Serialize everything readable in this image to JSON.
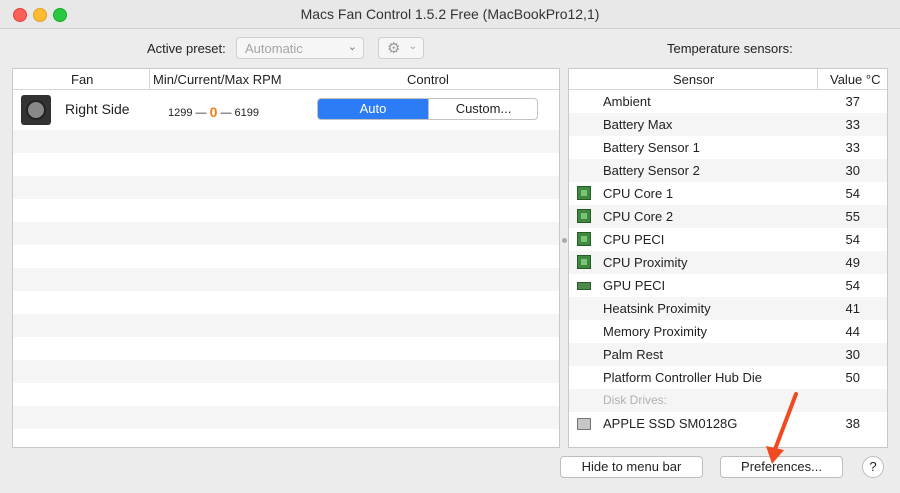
{
  "window": {
    "title": "Macs Fan Control 1.5.2 Free (MacBookPro12,1)"
  },
  "toolbar": {
    "preset_label": "Active preset:",
    "preset_value": "Automatic",
    "sensors_label": "Temperature sensors:"
  },
  "fan_table": {
    "headers": {
      "fan": "Fan",
      "rpm": "Min/Current/Max RPM",
      "control": "Control"
    },
    "fans": [
      {
        "name": "Right Side",
        "min": "1299",
        "current": "0",
        "max": "6199",
        "auto_label": "Auto",
        "custom_label": "Custom..."
      }
    ]
  },
  "sensor_table": {
    "headers": {
      "sensor": "Sensor",
      "value": "Value °C"
    },
    "sensors": [
      {
        "name": "Ambient",
        "value": "37",
        "icon": "none"
      },
      {
        "name": "Battery Max",
        "value": "33",
        "icon": "none"
      },
      {
        "name": "Battery Sensor 1",
        "value": "33",
        "icon": "none"
      },
      {
        "name": "Battery Sensor 2",
        "value": "30",
        "icon": "none"
      },
      {
        "name": "CPU Core 1",
        "value": "54",
        "icon": "chip-icon"
      },
      {
        "name": "CPU Core 2",
        "value": "55",
        "icon": "chip-icon"
      },
      {
        "name": "CPU PECI",
        "value": "54",
        "icon": "chip-icon"
      },
      {
        "name": "CPU Proximity",
        "value": "49",
        "icon": "chip-icon"
      },
      {
        "name": "GPU PECI",
        "value": "54",
        "icon": "gpu-icon"
      },
      {
        "name": "Heatsink Proximity",
        "value": "41",
        "icon": "none"
      },
      {
        "name": "Memory Proximity",
        "value": "44",
        "icon": "none"
      },
      {
        "name": "Palm Rest",
        "value": "30",
        "icon": "none"
      },
      {
        "name": "Platform Controller Hub Die",
        "value": "50",
        "icon": "none"
      }
    ],
    "disk_group_label": "Disk Drives:",
    "disks": [
      {
        "name": "APPLE SSD SM0128G",
        "value": "38",
        "icon": "disk-icon"
      }
    ]
  },
  "footer": {
    "hide_label": "Hide to menu bar",
    "prefs_label": "Preferences...",
    "help_label": "?"
  },
  "colors": {
    "accent": "#2c7cf5",
    "rpm_current": "#f07c1c",
    "arrow": "#f04a23"
  }
}
